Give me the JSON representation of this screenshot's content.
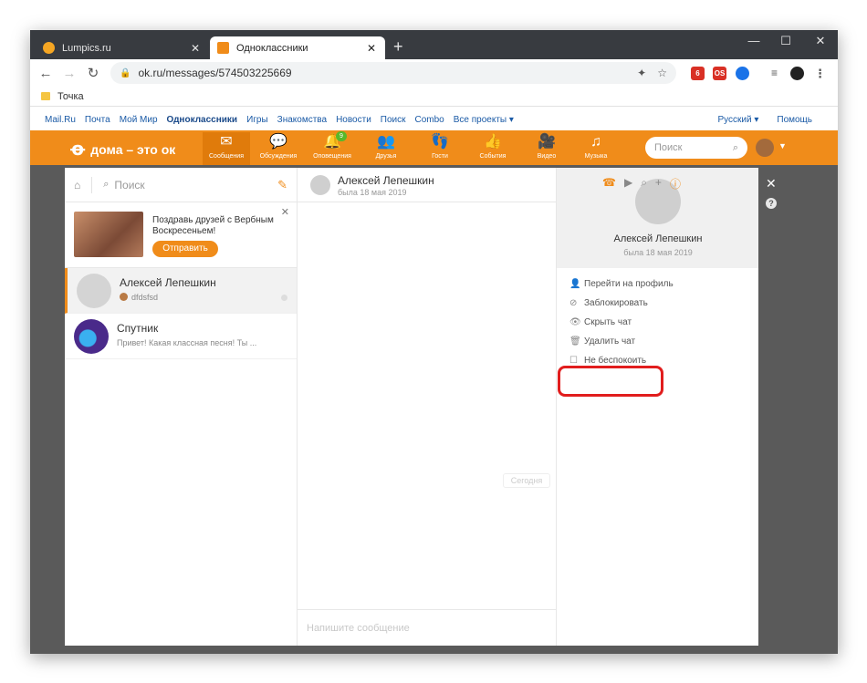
{
  "browser": {
    "tabs": [
      {
        "title": "Lumpics.ru",
        "favicon_color": "#f5a623"
      },
      {
        "title": "Одноклассники",
        "favicon_color": "#f08c1a"
      }
    ],
    "address": "ok.ru/messages/574503225669",
    "bookmark": "Точка",
    "extensions": [
      {
        "label": "6",
        "color": "#d93025"
      },
      {
        "label": "OS",
        "color": "#d93025"
      },
      {
        "label": "",
        "color": "#1a73e8"
      }
    ]
  },
  "ok_links": {
    "left": [
      "Mail.Ru",
      "Почта",
      "Мой Мир",
      "Одноклассники",
      "Игры",
      "Знакомства",
      "Новости",
      "Поиск",
      "Combo",
      "Все проекты ▾"
    ],
    "lang": "Русский ▾",
    "help": "Помощь"
  },
  "ok_bar": {
    "slogan": "дома – это ок",
    "nav": [
      {
        "icon": "✉",
        "label": "Сообщения"
      },
      {
        "icon": "💬",
        "label": "Обсуждения"
      },
      {
        "icon": "🔔",
        "label": "Оповещения",
        "badge": "9"
      },
      {
        "icon": "👥",
        "label": "Друзья"
      },
      {
        "icon": "👣",
        "label": "Гости"
      },
      {
        "icon": "👍",
        "label": "События"
      },
      {
        "icon": "🎥",
        "label": "Видео"
      },
      {
        "icon": "♫",
        "label": "Музыка"
      }
    ],
    "search_placeholder": "Поиск",
    "accent": "#f08c1a"
  },
  "messenger": {
    "search_placeholder": "Поиск",
    "promo": {
      "text": "Поздравь друзей с Вербным Воскресеньем!",
      "button": "Отправить"
    },
    "chats": [
      {
        "name": "Алексей Лепешкин",
        "preview": "dfdsfsd",
        "active": true
      },
      {
        "name": "Спутник",
        "preview": "Привет! Какая классная песня! Ты ..."
      }
    ],
    "header": {
      "name": "Алексей Лепешкин",
      "status": "была 18 мая 2019"
    },
    "today": "Сегодня",
    "compose_placeholder": "Напишите сообщение",
    "info": {
      "name": "Алексей Лепешкин",
      "status": "была 18 мая 2019",
      "menu": [
        {
          "icon": "👤",
          "label": "Перейти на профиль"
        },
        {
          "icon": "⊘",
          "label": "Заблокировать"
        },
        {
          "icon": "👁",
          "label": "Скрыть чат"
        },
        {
          "icon": "🗑",
          "label": "Удалить чат"
        },
        {
          "icon": "☐",
          "label": "Не беспокоить"
        }
      ]
    }
  }
}
